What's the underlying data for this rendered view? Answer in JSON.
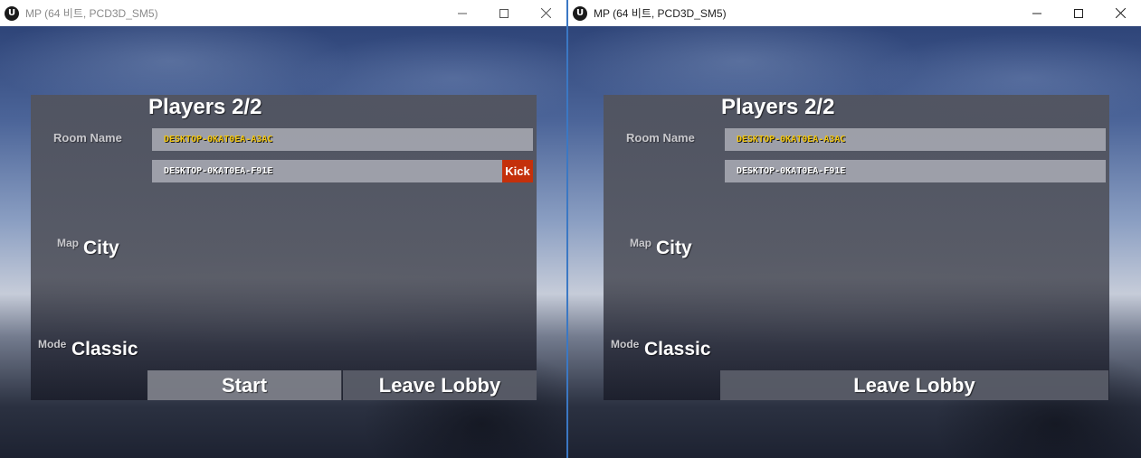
{
  "windows": [
    {
      "title": "MP (64 비트, PCD3D_SM5)",
      "lobby": {
        "players_title": "Players 2/2",
        "room_name_label": "Room Name",
        "host_player": "DESKTOP-0KAT0EA-A3AC",
        "guest_player": "DESKTOP-0KAT0EA-F91E",
        "kick_label": "Kick",
        "map_label": "Map",
        "map_value": "City",
        "mode_label": "Mode",
        "mode_value": "Classic",
        "start_label": "Start",
        "leave_label": "Leave Lobby"
      }
    },
    {
      "title": "MP (64 비트, PCD3D_SM5)",
      "lobby": {
        "players_title": "Players 2/2",
        "room_name_label": "Room Name",
        "host_player": "DESKTOP-0KAT0EA-A3AC",
        "guest_player": "DESKTOP-0KAT0EA-F91E",
        "map_label": "Map",
        "map_value": "City",
        "mode_label": "Mode",
        "mode_value": "Classic",
        "leave_label": "Leave Lobby"
      }
    }
  ],
  "colors": {
    "host_name": "#f2c611",
    "kick_button": "#c4300b",
    "window_divider": "#3b78c4"
  },
  "icons": [
    "unreal-engine-logo-icon",
    "minimize-icon",
    "maximize-icon",
    "close-icon"
  ]
}
